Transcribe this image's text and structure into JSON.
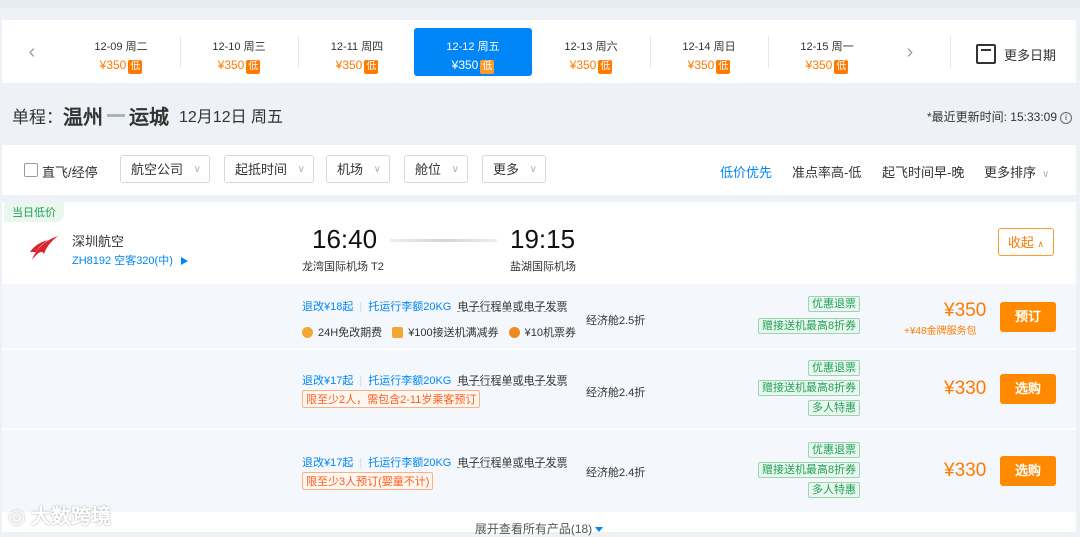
{
  "date_bar": {
    "dates": [
      {
        "date": "12-09",
        "weekday": "周二",
        "price": "¥350",
        "low": "低"
      },
      {
        "date": "12-10",
        "weekday": "周三",
        "price": "¥350",
        "low": "低"
      },
      {
        "date": "12-11",
        "weekday": "周四",
        "price": "¥350",
        "low": "低"
      },
      {
        "date": "12-12",
        "weekday": "周五",
        "price": "¥350",
        "low": "低"
      },
      {
        "date": "12-13",
        "weekday": "周六",
        "price": "¥350",
        "low": "低"
      },
      {
        "date": "12-14",
        "weekday": "周日",
        "price": "¥350",
        "low": "低"
      },
      {
        "date": "12-15",
        "weekday": "周一",
        "price": "¥350",
        "low": "低"
      }
    ],
    "selected_index": 3,
    "more_dates_label": "更多日期"
  },
  "route": {
    "trip_label": "单程：",
    "from": "温州",
    "to": "运城",
    "date_text": "12月12日 周五",
    "updated": "*最近更新时间: 15:33:09"
  },
  "filters": {
    "direct_label": "直飞/经停",
    "selects": [
      "航空公司",
      "起抵时间",
      "机场",
      "舱位",
      "更多"
    ],
    "sorts": [
      "低价优先",
      "准点率高-低",
      "起飞时间早-晚",
      "更多排序"
    ],
    "active_sort_index": 0
  },
  "flight": {
    "today_low_tag": "当日低价",
    "airline": "深圳航空",
    "flight_no": "ZH8192 空客320(中)",
    "dep_time": "16:40",
    "dep_airport": "龙湾国际机场 T2",
    "arr_time": "19:15",
    "arr_airport": "盐湖国际机场",
    "collapse_label": "收起",
    "products": [
      {
        "change": "退改¥18起",
        "baggage": "托运行李额20KG",
        "doc": "电子行程单或电子发票",
        "extras": [
          "24H免改期费",
          "¥100接送机满减券",
          "¥10机票券"
        ],
        "warn": "",
        "cabin": "经济舱2.5折",
        "green_tags": [
          "优惠退票",
          "赠接送机最高8折券"
        ],
        "price": "¥350",
        "service": "+¥48金牌服务包",
        "button": "预订"
      },
      {
        "change": "退改¥17起",
        "baggage": "托运行李额20KG",
        "doc": "电子行程单或电子发票",
        "extras": [],
        "warn": "限至少2人，需包含2-11岁乘客预订",
        "cabin": "经济舱2.4折",
        "green_tags": [
          "优惠退票",
          "赠接送机最高8折券",
          "多人特惠"
        ],
        "price": "¥330",
        "service": "",
        "button": "选购"
      },
      {
        "change": "退改¥17起",
        "baggage": "托运行李额20KG",
        "doc": "电子行程单或电子发票",
        "extras": [],
        "warn": "限至少3人预订(婴童不计)",
        "cabin": "经济舱2.4折",
        "green_tags": [
          "优惠退票",
          "赠接送机最高8折券",
          "多人特惠"
        ],
        "price": "¥330",
        "service": "",
        "button": "选购"
      }
    ],
    "expand_label": "展开查看所有产品(18)"
  },
  "watermark": "大数跨境",
  "colors": {
    "accent": "#0086f6",
    "price": "#ff7a00",
    "green": "#22a05a"
  }
}
